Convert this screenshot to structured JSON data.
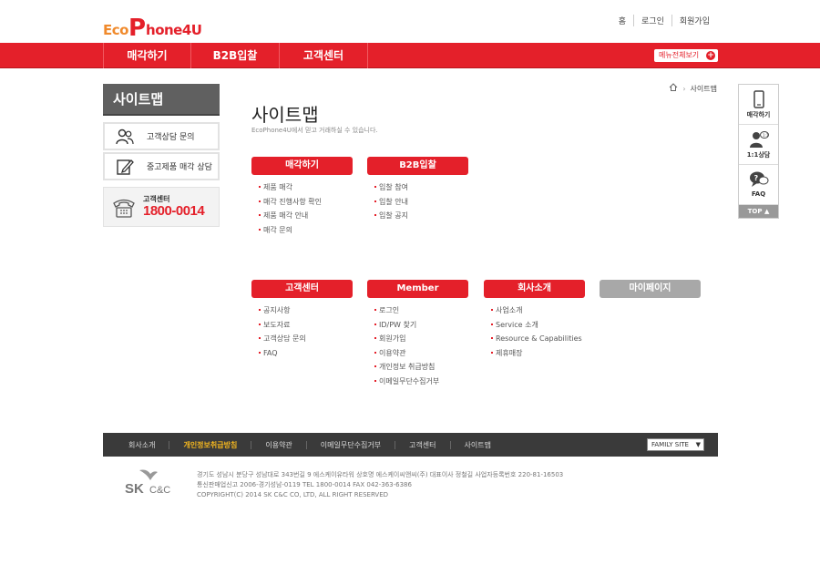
{
  "brand": {
    "eco": "Eco",
    "p": "P",
    "rest": "hone4U"
  },
  "util_links": [
    "홈",
    "로그인",
    "회원가입"
  ],
  "nav": {
    "items": [
      "매각하기",
      "B2B입찰",
      "고객센터"
    ],
    "all_menu": "메뉴전체보기",
    "all_menu_icon": "+"
  },
  "sidebar": {
    "title": "사이트맵",
    "buttons": [
      {
        "label": "고객상담 문의",
        "icon": "users-icon"
      },
      {
        "label": "중고제품 매각 상담",
        "icon": "edit-icon"
      }
    ],
    "call": {
      "label": "고객센터",
      "number": "1800-0014"
    }
  },
  "breadcrumb": {
    "current": "사이트맵"
  },
  "page": {
    "title": "사이트맵",
    "subtitle": "EcoPhone4U에서 믿고 거래하실 수 있습니다."
  },
  "groups": [
    {
      "title": "매각하기",
      "items": [
        "제품 매각",
        "매각 진행사항 확인",
        "제품 매각 안내",
        "매각 문의"
      ]
    },
    {
      "title": "B2B입찰",
      "items": [
        "입찰 참여",
        "입찰 안내",
        "입찰 공지"
      ]
    },
    {
      "title": "고객센터",
      "items": [
        "공지사항",
        "보도자료",
        "고객상담 문의",
        "FAQ"
      ]
    },
    {
      "title": "Member",
      "items": [
        "로그인",
        "ID/PW 찾기",
        "회원가입",
        "이용약관",
        "개인정보 취급방침",
        "이메일무단수집거부"
      ]
    },
    {
      "title": "회사소개",
      "items": [
        "사업소개",
        "Service 소개",
        "Resource & Capabilities",
        "제휴매장"
      ]
    },
    {
      "title": "마이페이지",
      "items": []
    }
  ],
  "quick": {
    "items": [
      "매각하기",
      "1:1상담",
      "FAQ"
    ],
    "top": "TOP ▲"
  },
  "footer": {
    "links": [
      "회사소개",
      "개인정보취급방침",
      "이용약관",
      "이메일무단수집거부",
      "고객센터",
      "사이트맵"
    ],
    "family": "FAMILY SITE",
    "logo_sk": "SK",
    "logo_cc": "C&C",
    "address": [
      "경기도 성남시 분당구 성남대로 343번길 9 에스케이유타워  상호명 에스케이씨앤씨(주)  대표이사 정철길  사업자등록번호 220-81-16503",
      "통신판매업신고 2006-경기성남-0119  TEL 1800-0014  FAX 042-363-6386",
      "COPYRIGHT(C) 2014 SK C&C CO, LTD, ALL RIGHT RESERVED"
    ]
  },
  "colors": {
    "accent": "#e4202a",
    "orange": "#f08a2c",
    "footer_bg": "#3a3a3a",
    "highlight": "#f3b61f"
  }
}
